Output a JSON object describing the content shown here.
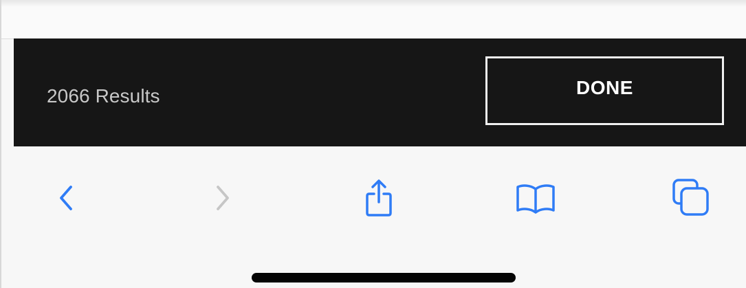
{
  "results_bar": {
    "count_text": "2066 Results",
    "done_label": "DONE"
  },
  "toolbar": {
    "items": [
      {
        "name": "back",
        "icon": "chevron-left-icon",
        "enabled": true
      },
      {
        "name": "forward",
        "icon": "chevron-right-icon",
        "enabled": false
      },
      {
        "name": "share",
        "icon": "share-icon",
        "enabled": true
      },
      {
        "name": "bookmarks",
        "icon": "book-icon",
        "enabled": true
      },
      {
        "name": "tabs",
        "icon": "tabs-icon",
        "enabled": true
      }
    ]
  },
  "colors": {
    "bar_background": "#161616",
    "results_text": "#c8c8c8",
    "button_border": "#f0f0f0",
    "toolbar_background": "#f7f7f7",
    "icon_blue": "#2f7cf6",
    "icon_disabled": "#c6c6c6",
    "home_indicator": "#050505"
  }
}
